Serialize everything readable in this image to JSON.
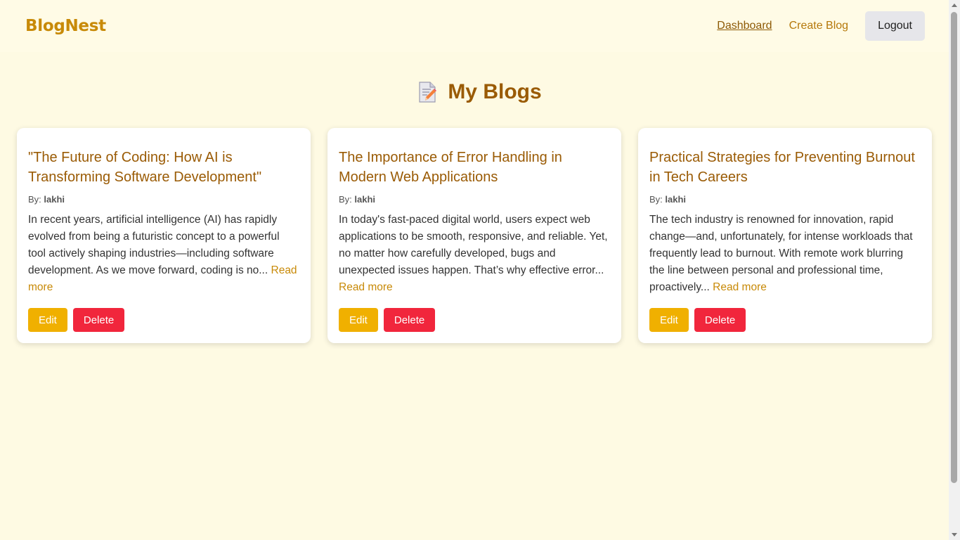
{
  "navbar": {
    "brand": "BlogNest",
    "links": [
      {
        "label": "Dashboard",
        "active": true
      },
      {
        "label": "Create Blog",
        "active": false
      }
    ],
    "logout_label": "Logout"
  },
  "page": {
    "title": "My Blogs",
    "title_icon": "memo-icon"
  },
  "blogs": [
    {
      "title": "\"The Future of Coding: How AI is Transforming Software Development\"",
      "by_label": "By:",
      "author": "lakhi",
      "excerpt": "In recent years, artificial intelligence (AI) has rapidly evolved from being a futuristic concept to a powerful tool actively shaping industries—including software development. As we move forward, coding is no...",
      "read_more": "Read more",
      "edit_label": "Edit",
      "delete_label": "Delete"
    },
    {
      "title": "The Importance of Error Handling in Modern Web Applications",
      "by_label": "By:",
      "author": "lakhi",
      "excerpt": "In today's fast-paced digital world, users expect web applications to be smooth, responsive, and reliable. Yet, no matter how carefully developed, bugs and unexpected issues happen. That’s why effective error...",
      "read_more": "Read more",
      "edit_label": "Edit",
      "delete_label": "Delete"
    },
    {
      "title": "Practical Strategies for Preventing Burnout in Tech Careers",
      "by_label": "By:",
      "author": "lakhi",
      "excerpt": "The tech industry is renowned for innovation, rapid change—and, unfortunately, for intense workloads that frequently lead to burnout. With remote work blurring the line between personal and professional time, proactively...",
      "read_more": "Read more",
      "edit_label": "Edit",
      "delete_label": "Delete"
    }
  ],
  "colors": {
    "background": "#fefae3",
    "accent": "#c88a08",
    "title": "#9a5b05",
    "edit": "#f0b000",
    "delete": "#f1263c"
  }
}
